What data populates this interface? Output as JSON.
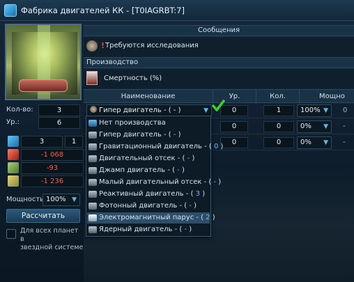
{
  "window": {
    "title": "Фабрика двигателей КК - [T0IAGRBT:7]"
  },
  "left": {
    "count_label": "Кол-во:",
    "count_value": "3",
    "level_label": "Ур.:",
    "level_value": "6",
    "resources": [
      {
        "icon": "energy-ship-icon",
        "value_a": "3",
        "value_b": "1"
      },
      {
        "icon": "lightning-icon",
        "value": "-1 068",
        "color": "#ff5a4a"
      },
      {
        "icon": "metal-icon",
        "value": "-93",
        "color": "#ff5a4a"
      },
      {
        "icon": "crystal-icon",
        "value": "-1 236",
        "color": "#ff5a4a"
      }
    ],
    "power_label": "Мощность:",
    "power_value": "100%",
    "calc_button": "Рассчитать",
    "all_planets_label_1": "Для всех планет в",
    "all_planets_label_2": "звездной системе"
  },
  "messages": {
    "header": "Сообщения",
    "text": "Требуются исследования"
  },
  "production": {
    "header": "Производство",
    "mortality_label": "Смертность (%)",
    "columns": [
      "Наименование",
      "Ур.",
      "Кол.",
      "Мощно"
    ],
    "rows": [
      {
        "name": "Гипер двигатель - ( - )",
        "level": "0",
        "qty": "1",
        "power": "100%",
        "extra": "0"
      },
      {
        "name": "",
        "level": "0",
        "qty": "0",
        "power": "0%",
        "extra": "-"
      },
      {
        "name": "",
        "level": "0",
        "qty": "0",
        "power": "0%",
        "extra": "-"
      }
    ]
  },
  "dropdown": {
    "options": [
      {
        "label": "Нет производства",
        "count": ""
      },
      {
        "label": "Гипер двигатель - (",
        "count": " - ",
        "close": ")"
      },
      {
        "label": "Гравитационный двигатель - (",
        "count": " 0 ",
        "close": ")"
      },
      {
        "label": "Двигательный отсек - (",
        "count": " - ",
        "close": ")"
      },
      {
        "label": "Джамп двигатель - (",
        "count": " - ",
        "close": ")"
      },
      {
        "label": "Малый двигательный отсек - (",
        "count": " - ",
        "close": ")"
      },
      {
        "label": "Реактивный двигатель - (",
        "count": " 3 ",
        "close": ")"
      },
      {
        "label": "Фотонный двигатель - (",
        "count": " - ",
        "close": ")"
      },
      {
        "label": "Электромагнитный парус - (",
        "count": " 2 ",
        "close": ")"
      },
      {
        "label": "Ядерный двигатель - (",
        "count": " - ",
        "close": ")"
      }
    ]
  },
  "colors": {
    "accent": "#5fb6e8",
    "negative": "#ff5a4a",
    "check": "#39d12b"
  }
}
